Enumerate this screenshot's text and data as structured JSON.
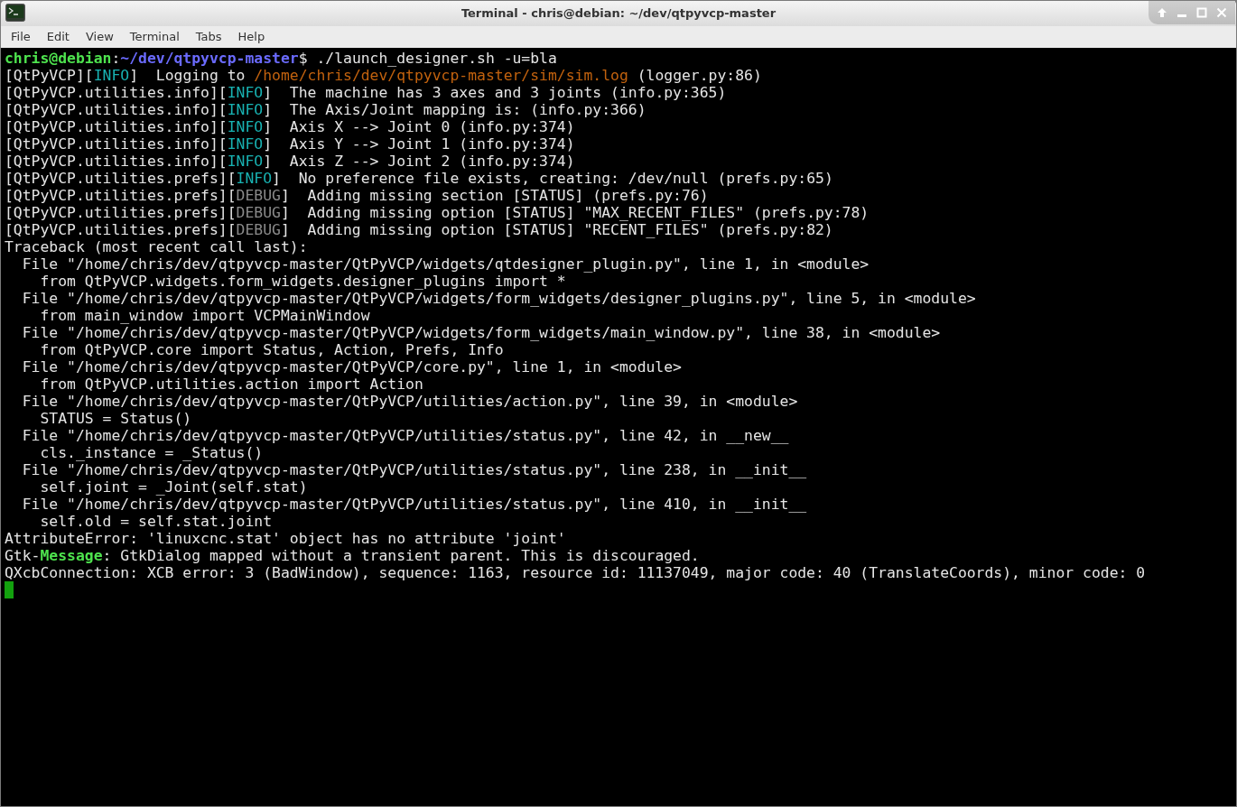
{
  "window": {
    "title": "Terminal - chris@debian: ~/dev/qtpyvcp-master"
  },
  "menu": [
    "File",
    "Edit",
    "View",
    "Terminal",
    "Tabs",
    "Help"
  ],
  "terminal": {
    "lines": [
      [
        {
          "kind": "user",
          "text": "chris@debian"
        },
        {
          "kind": "plain",
          "text": ":"
        },
        {
          "kind": "cwd",
          "text": "~/dev/qtpyvcp-master"
        },
        {
          "kind": "plain",
          "text": "$ ./launch_designer.sh -u=bla"
        }
      ],
      [
        {
          "kind": "plain",
          "text": "[QtPyVCP]["
        },
        {
          "kind": "info",
          "text": "INFO"
        },
        {
          "kind": "plain",
          "text": "]  Logging to "
        },
        {
          "kind": "path",
          "text": "/home/chris/dev/qtpyvcp-master/sim/sim.log"
        },
        {
          "kind": "plain",
          "text": " (logger.py:86)"
        }
      ],
      [
        {
          "kind": "plain",
          "text": "[QtPyVCP.utilities.info]["
        },
        {
          "kind": "info",
          "text": "INFO"
        },
        {
          "kind": "plain",
          "text": "]  The machine has 3 axes and 3 joints (info.py:365)"
        }
      ],
      [
        {
          "kind": "plain",
          "text": "[QtPyVCP.utilities.info]["
        },
        {
          "kind": "info",
          "text": "INFO"
        },
        {
          "kind": "plain",
          "text": "]  The Axis/Joint mapping is: (info.py:366)"
        }
      ],
      [
        {
          "kind": "plain",
          "text": "[QtPyVCP.utilities.info]["
        },
        {
          "kind": "info",
          "text": "INFO"
        },
        {
          "kind": "plain",
          "text": "]  Axis X --> Joint 0 (info.py:374)"
        }
      ],
      [
        {
          "kind": "plain",
          "text": "[QtPyVCP.utilities.info]["
        },
        {
          "kind": "info",
          "text": "INFO"
        },
        {
          "kind": "plain",
          "text": "]  Axis Y --> Joint 1 (info.py:374)"
        }
      ],
      [
        {
          "kind": "plain",
          "text": "[QtPyVCP.utilities.info]["
        },
        {
          "kind": "info",
          "text": "INFO"
        },
        {
          "kind": "plain",
          "text": "]  Axis Z --> Joint 2 (info.py:374)"
        }
      ],
      [
        {
          "kind": "plain",
          "text": "[QtPyVCP.utilities.prefs]["
        },
        {
          "kind": "info",
          "text": "INFO"
        },
        {
          "kind": "plain",
          "text": "]  No preference file exists, creating: /dev/null (prefs.py:65)"
        }
      ],
      [
        {
          "kind": "plain",
          "text": "[QtPyVCP.utilities.prefs]["
        },
        {
          "kind": "debug",
          "text": "DEBUG"
        },
        {
          "kind": "plain",
          "text": "]  Adding missing section [STATUS] (prefs.py:76)"
        }
      ],
      [
        {
          "kind": "plain",
          "text": "[QtPyVCP.utilities.prefs]["
        },
        {
          "kind": "debug",
          "text": "DEBUG"
        },
        {
          "kind": "plain",
          "text": "]  Adding missing option [STATUS] \"MAX_RECENT_FILES\" (prefs.py:78)"
        }
      ],
      [
        {
          "kind": "plain",
          "text": "[QtPyVCP.utilities.prefs]["
        },
        {
          "kind": "debug",
          "text": "DEBUG"
        },
        {
          "kind": "plain",
          "text": "]  Adding missing option [STATUS] \"RECENT_FILES\" (prefs.py:82)"
        }
      ],
      [
        {
          "kind": "plain",
          "text": "Traceback (most recent call last):"
        }
      ],
      [
        {
          "kind": "plain",
          "text": "  File \"/home/chris/dev/qtpyvcp-master/QtPyVCP/widgets/qtdesigner_plugin.py\", line 1, in <module>"
        }
      ],
      [
        {
          "kind": "plain",
          "text": "    from QtPyVCP.widgets.form_widgets.designer_plugins import *"
        }
      ],
      [
        {
          "kind": "plain",
          "text": "  File \"/home/chris/dev/qtpyvcp-master/QtPyVCP/widgets/form_widgets/designer_plugins.py\", line 5, in <module>"
        }
      ],
      [
        {
          "kind": "plain",
          "text": "    from main_window import VCPMainWindow"
        }
      ],
      [
        {
          "kind": "plain",
          "text": "  File \"/home/chris/dev/qtpyvcp-master/QtPyVCP/widgets/form_widgets/main_window.py\", line 38, in <module>"
        }
      ],
      [
        {
          "kind": "plain",
          "text": "    from QtPyVCP.core import Status, Action, Prefs, Info"
        }
      ],
      [
        {
          "kind": "plain",
          "text": "  File \"/home/chris/dev/qtpyvcp-master/QtPyVCP/core.py\", line 1, in <module>"
        }
      ],
      [
        {
          "kind": "plain",
          "text": "    from QtPyVCP.utilities.action import Action"
        }
      ],
      [
        {
          "kind": "plain",
          "text": "  File \"/home/chris/dev/qtpyvcp-master/QtPyVCP/utilities/action.py\", line 39, in <module>"
        }
      ],
      [
        {
          "kind": "plain",
          "text": "    STATUS = Status()"
        }
      ],
      [
        {
          "kind": "plain",
          "text": "  File \"/home/chris/dev/qtpyvcp-master/QtPyVCP/utilities/status.py\", line 42, in __new__"
        }
      ],
      [
        {
          "kind": "plain",
          "text": "    cls._instance = _Status()"
        }
      ],
      [
        {
          "kind": "plain",
          "text": "  File \"/home/chris/dev/qtpyvcp-master/QtPyVCP/utilities/status.py\", line 238, in __init__"
        }
      ],
      [
        {
          "kind": "plain",
          "text": "    self.joint = _Joint(self.stat)"
        }
      ],
      [
        {
          "kind": "plain",
          "text": "  File \"/home/chris/dev/qtpyvcp-master/QtPyVCP/utilities/status.py\", line 410, in __init__"
        }
      ],
      [
        {
          "kind": "plain",
          "text": "    self.old = self.stat.joint"
        }
      ],
      [
        {
          "kind": "plain",
          "text": "AttributeError: 'linuxcnc.stat' object has no attribute 'joint'"
        }
      ],
      [
        {
          "kind": "plain",
          "text": "Gtk-"
        },
        {
          "kind": "message",
          "text": "Message"
        },
        {
          "kind": "plain",
          "text": ": GtkDialog mapped without a transient parent. This is discouraged."
        }
      ],
      [
        {
          "kind": "plain",
          "text": "QXcbConnection: XCB error: 3 (BadWindow), sequence: 1163, resource id: 11137049, major code: 40 (TranslateCoords), minor code: 0"
        }
      ]
    ]
  }
}
